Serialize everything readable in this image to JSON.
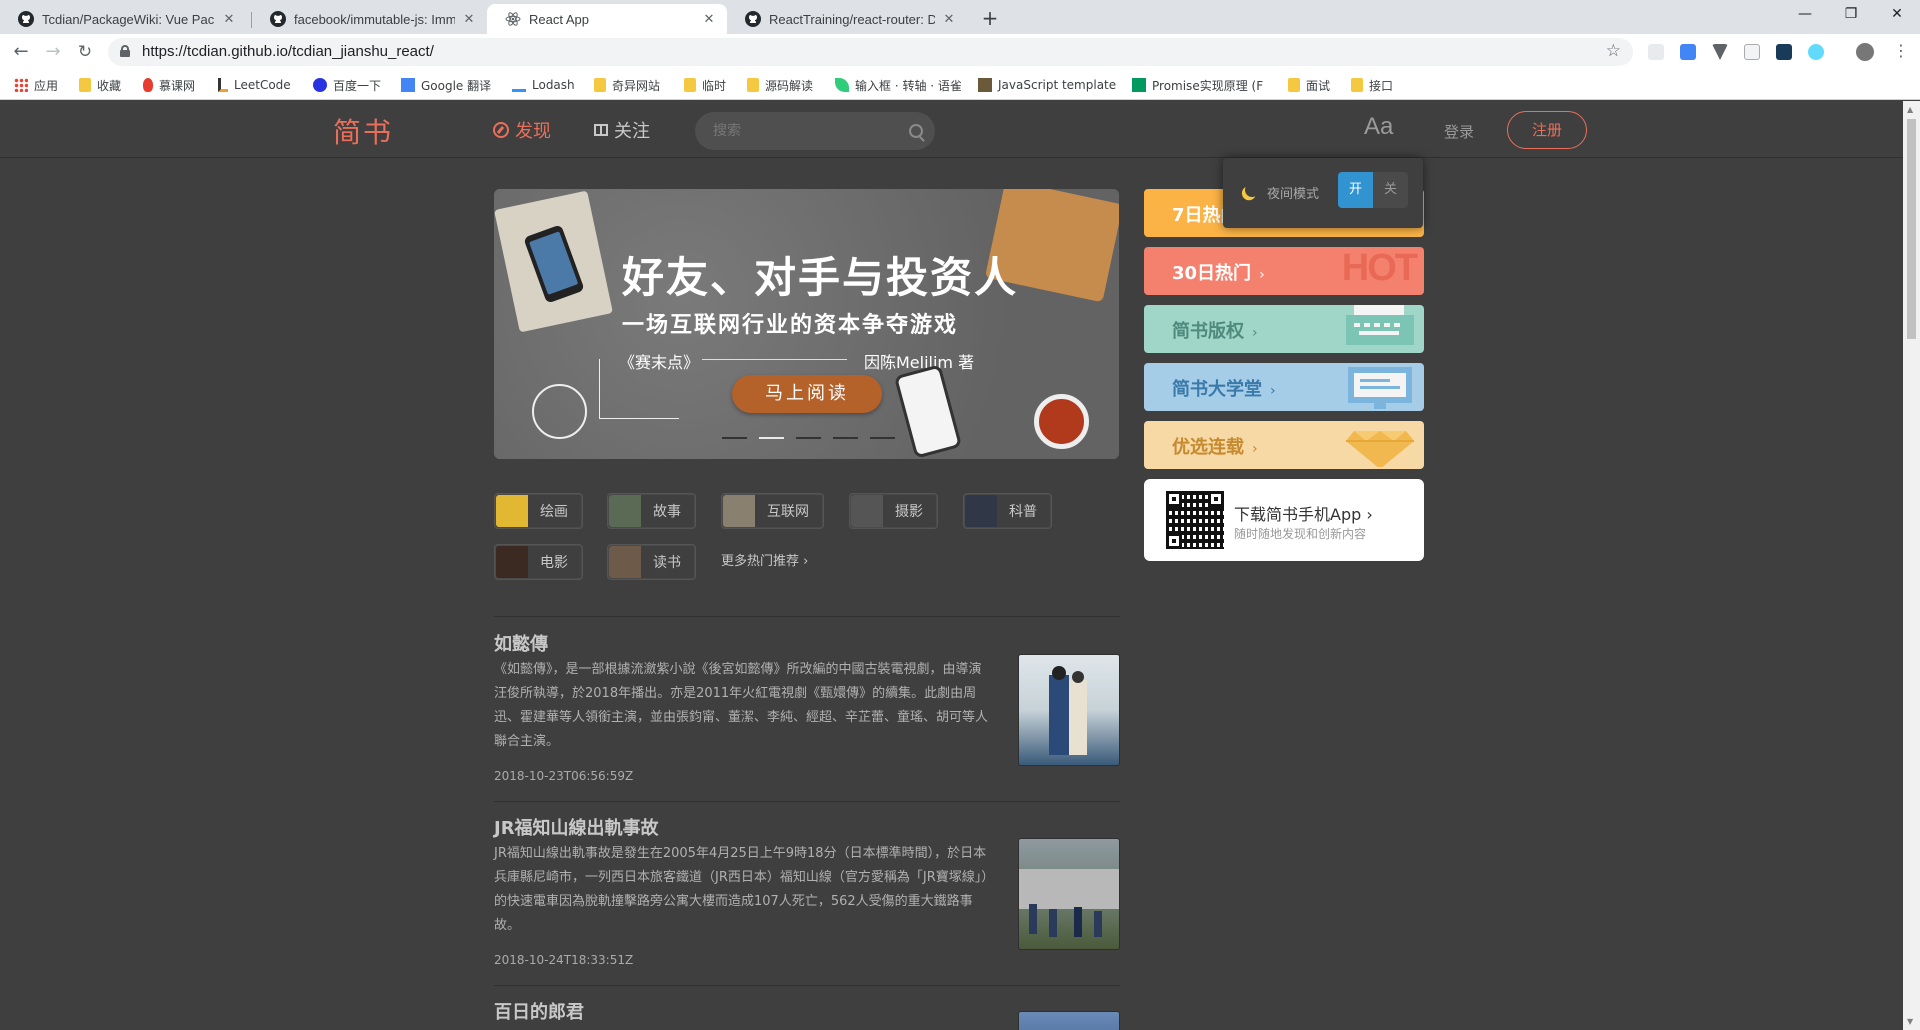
{
  "browser": {
    "tabs": [
      {
        "title": "Tcdian/PackageWiki: Vue Pack",
        "icon": "github-icon",
        "active": false
      },
      {
        "title": "facebook/immutable-js: Immu",
        "icon": "github-icon",
        "active": false
      },
      {
        "title": "React App",
        "icon": "react-icon",
        "active": true
      },
      {
        "title": "ReactTraining/react-router: De",
        "icon": "github-icon",
        "active": false
      }
    ],
    "close_glyph": "✕",
    "newtab_glyph": "+",
    "window": {
      "minimize": "—",
      "maximize": "❐",
      "close": "✕"
    },
    "url": "https://tcdian.github.io/tcdian_jianshu_react/",
    "bookmarks": [
      {
        "label": "应用",
        "icon": "apps-grid-icon"
      },
      {
        "label": "收藏",
        "icon": "folder-icon"
      },
      {
        "label": "慕课网",
        "icon": "fire-icon"
      },
      {
        "label": "LeetCode",
        "icon": "leetcode-icon"
      },
      {
        "label": "百度一下",
        "icon": "baidu-paw-icon"
      },
      {
        "label": "Google 翻译",
        "icon": "google-translate-icon"
      },
      {
        "label": "Lodash",
        "icon": "lodash-icon"
      },
      {
        "label": "奇异网站",
        "icon": "folder-icon"
      },
      {
        "label": "临时",
        "icon": "folder-icon"
      },
      {
        "label": "源码解读",
        "icon": "folder-icon"
      },
      {
        "label": "输入框 · 转轴 · 语雀",
        "icon": "yuque-icon"
      },
      {
        "label": "JavaScript template",
        "icon": "template-icon"
      },
      {
        "label": "Promise实现原理 (F",
        "icon": "segmentfault-icon"
      },
      {
        "label": "面试",
        "icon": "folder-icon"
      },
      {
        "label": "接口",
        "icon": "folder-icon"
      }
    ]
  },
  "header": {
    "logo": "简书",
    "nav_discover": "发现",
    "nav_follow": "关注",
    "search_placeholder": "搜索",
    "font_toggle": "Aa",
    "login": "登录",
    "register": "注册"
  },
  "night_mode": {
    "label": "夜间模式",
    "on": "开",
    "off": "关"
  },
  "banner": {
    "title": "好友、对手与投资人",
    "subtitle": "一场互联网行业的资本争夺游戏",
    "book": "《赛末点》",
    "author": "因陈Melilim  著",
    "cta": "马上阅读",
    "slides": 5,
    "active_slide": 2
  },
  "topics": [
    {
      "label": "绘画",
      "color": "#e2b832"
    },
    {
      "label": "故事",
      "color": "#5a6a55"
    },
    {
      "label": "互联网",
      "color": "#8a8070"
    },
    {
      "label": "摄影",
      "color": "#555555"
    },
    {
      "label": "科普",
      "color": "#303848"
    },
    {
      "label": "电影",
      "color": "#3a2a22"
    },
    {
      "label": "读书",
      "color": "#6e5a48"
    }
  ],
  "more_topics": "更多热门推荐",
  "articles": [
    {
      "title": "如懿傳",
      "abstract": "《如懿傳》，是一部根據流瀲紫小說《後宮如懿傳》所改編的中國古裝電視劇，由導演汪俊所執導，於2018年播出。亦是2011年火紅電視劇《甄嬛傳》的續集。此劇由周迅、霍建華等人領銜主演，並由張鈞甯、董潔、李純、經超、辛芷蕾、童瑤、胡可等人聯合主演。",
      "time": "2018-10-23T06:56:59Z"
    },
    {
      "title": "JR福知山線出軌事故",
      "abstract": "JR福知山線出軌事故是發生在2005年4月25日上午9時18分（日本標準時間），於日本兵庫縣尼崎市，一列西日本旅客鐵道（JR西日本）福知山線（官方愛稱為「JR寶塚線」）的快速電車因為脫軌撞擊路旁公寓大樓而造成107人死亡，562人受傷的重大鐵路事故。",
      "time": "2018-10-24T18:33:51Z"
    },
    {
      "title": "百日的郎君",
      "abstract": "",
      "time": ""
    }
  ],
  "boards": [
    {
      "label": "7日热门",
      "color": "#fbb346"
    },
    {
      "label": "30日热门",
      "color": "#f4806e"
    },
    {
      "label": "简书版权",
      "color": "#9fd6c8"
    },
    {
      "label": "简书大学堂",
      "color": "#a5cde8"
    },
    {
      "label": "优选连载",
      "color": "#f6d9a4"
    }
  ],
  "board_decor": {
    "hot": "HOT"
  },
  "app_download": {
    "title": "下载简书手机App",
    "subtitle": "随时随地发现和创新内容"
  },
  "colors": {
    "accent": "#ea6f5a",
    "page_bg": "#3f3f3f",
    "toggle_on": "#3194d0"
  }
}
